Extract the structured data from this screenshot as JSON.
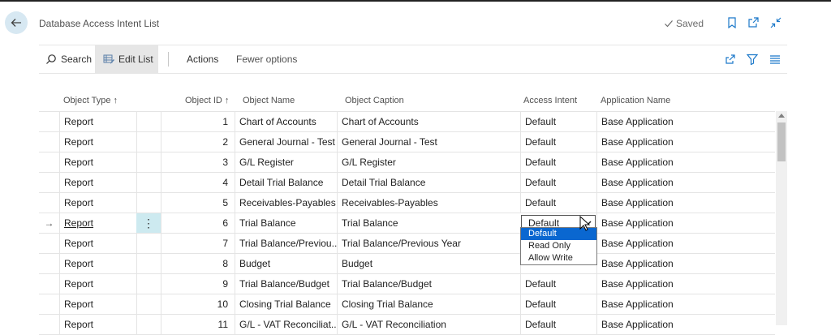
{
  "header": {
    "title": "Database Access Intent List",
    "saved_label": "Saved",
    "icons": [
      "back-arrow-icon",
      "bookmark-icon",
      "open-in-new-window-icon",
      "collapse-icon"
    ]
  },
  "toolbar": {
    "search_label": "Search",
    "edit_list_label": "Edit List",
    "actions_label": "Actions",
    "fewer_options_label": "Fewer options",
    "right_icons": [
      "share-icon",
      "filter-icon",
      "list-view-icon"
    ]
  },
  "columns": {
    "object_type": "Object Type ↑",
    "object_id": "Object ID ↑",
    "object_name": "Object Name",
    "object_caption": "Object Caption",
    "access_intent": "Access Intent",
    "application_name": "Application Name"
  },
  "rows": [
    {
      "type": "Report",
      "id": "1",
      "name": "Chart of Accounts",
      "caption": "Chart of Accounts",
      "intent": "Default",
      "app": "Base Application"
    },
    {
      "type": "Report",
      "id": "2",
      "name": "General Journal - Test",
      "caption": "General Journal - Test",
      "intent": "Default",
      "app": "Base Application"
    },
    {
      "type": "Report",
      "id": "3",
      "name": "G/L Register",
      "caption": "G/L Register",
      "intent": "Default",
      "app": "Base Application"
    },
    {
      "type": "Report",
      "id": "4",
      "name": "Detail Trial Balance",
      "caption": "Detail Trial Balance",
      "intent": "Default",
      "app": "Base Application"
    },
    {
      "type": "Report",
      "id": "5",
      "name": "Receivables-Payables",
      "caption": "Receivables-Payables",
      "intent": "Default",
      "app": "Base Application"
    },
    {
      "type": "Report",
      "id": "6",
      "name": "Trial Balance",
      "caption": "Trial Balance",
      "intent": "Default",
      "app": "Base Application"
    },
    {
      "type": "Report",
      "id": "7",
      "name": "Trial Balance/Previou...",
      "caption": "Trial Balance/Previous Year",
      "intent": "",
      "app": "Base Application"
    },
    {
      "type": "Report",
      "id": "8",
      "name": "Budget",
      "caption": "Budget",
      "intent": "",
      "app": "Base Application"
    },
    {
      "type": "Report",
      "id": "9",
      "name": "Trial Balance/Budget",
      "caption": "Trial Balance/Budget",
      "intent": "Default",
      "app": "Base Application"
    },
    {
      "type": "Report",
      "id": "10",
      "name": "Closing Trial Balance",
      "caption": "Closing Trial Balance",
      "intent": "Default",
      "app": "Base Application"
    },
    {
      "type": "Report",
      "id": "11",
      "name": "G/L - VAT Reconciliat...",
      "caption": "G/L - VAT Reconciliation",
      "intent": "Default",
      "app": "Base Application"
    }
  ],
  "active_row": {
    "indicator": "→",
    "more_options": "⋮",
    "select_value": "Default"
  },
  "dropdown_options": [
    "Default",
    "Read Only",
    "Allow Write"
  ]
}
